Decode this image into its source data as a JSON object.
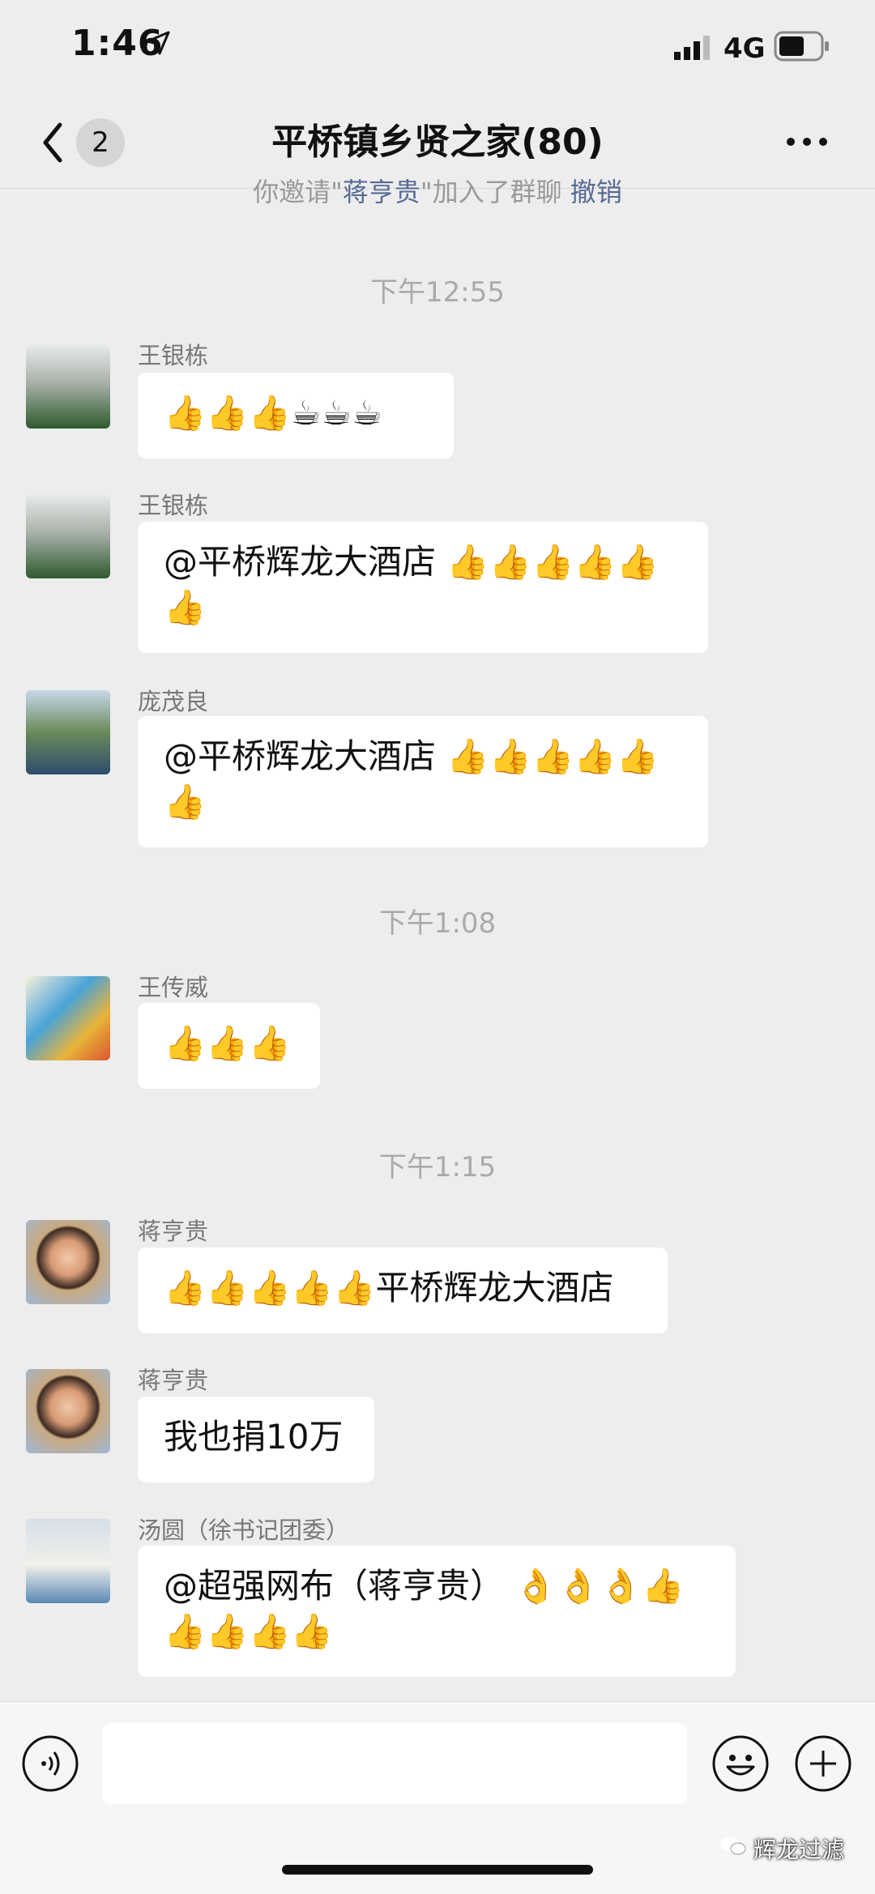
{
  "status_bar": {
    "time": "1:46",
    "network": "4G"
  },
  "nav": {
    "unread_count": "2",
    "title": "平桥镇乡贤之家(80)"
  },
  "system_message": {
    "pre": "你邀请\"",
    "name": "蒋亨贵",
    "mid": "\"加入了群聊 ",
    "action": "撤销"
  },
  "timestamps": [
    "下午12:55",
    "下午1:08",
    "下午1:15"
  ],
  "messages": [
    {
      "sender": "王银栋",
      "text": "👍👍👍☕☕☕"
    },
    {
      "sender": "王银栋",
      "text": "@平桥辉龙大酒店 👍👍👍👍👍\n👍"
    },
    {
      "sender": "庞茂良",
      "text": "@平桥辉龙大酒店 👍👍👍👍👍\n👍"
    },
    {
      "sender": "王传威",
      "text": "👍👍👍"
    },
    {
      "sender": "蒋亨贵",
      "text": "👍👍👍👍👍平桥辉龙大酒店"
    },
    {
      "sender": "蒋亨贵",
      "text": "我也捐10万"
    },
    {
      "sender": "汤圆（徐书记团委）",
      "text": "@超强网布（蒋亨贵） 👌👌👌👍\n👍👍👍👍"
    }
  ],
  "input": {
    "value": ""
  },
  "watermark": "辉龙过滤",
  "colors": {
    "background": "#ededed",
    "bubble": "#ffffff",
    "link": "#576b95"
  }
}
